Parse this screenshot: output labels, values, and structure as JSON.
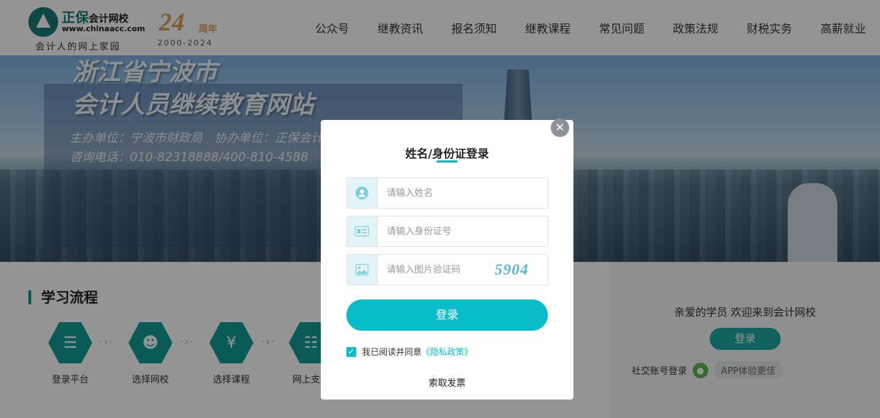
{
  "header": {
    "logo_cn": "正保",
    "logo_cn_small": "会计网校",
    "logo_url": "www.chinaacc.com",
    "logo_slogan": "会计人的网上家园",
    "anniv_num": "24",
    "anniv_suffix": "周年",
    "anniv_years": "2000-2024",
    "nav": [
      "公众号",
      "继教资讯",
      "报名须知",
      "继教课程",
      "常见问题",
      "政策法规",
      "财税实务",
      "高薪就业"
    ]
  },
  "banner": {
    "line1": "浙江省宁波市",
    "line2": "会计人员继续教育网站",
    "line3": "主办单位：宁波市财政局　协办单位：正保会计网校",
    "line4": "咨询电话：010-82318888/400-810-4588"
  },
  "process": {
    "title": "学习流程",
    "steps": [
      {
        "label": "登录平台",
        "icon": "clipboard-icon"
      },
      {
        "label": "选择网校",
        "icon": "user-check-icon"
      },
      {
        "label": "选择课程",
        "icon": "money-bag-icon"
      },
      {
        "label": "网上支付",
        "icon": "id-card-icon"
      }
    ]
  },
  "welcome": {
    "text": "亲爱的学员 欢迎来到会计网校",
    "login": "登录",
    "social_label": "社交账号登录",
    "app_label": "APP体验更佳"
  },
  "modal": {
    "title": "姓名/身份证登录",
    "name_placeholder": "请输入姓名",
    "id_placeholder": "请输入身份证号",
    "captcha_placeholder": "请输入图片验证码",
    "captcha_code": "5904",
    "login_button": "登录",
    "agree_text": "我已阅读并同意",
    "privacy_link": "《隐私政策》",
    "invoice_link": "索取发票",
    "agreed": true
  },
  "colors": {
    "accent": "#09bcc8",
    "brand": "#1b7b76"
  }
}
